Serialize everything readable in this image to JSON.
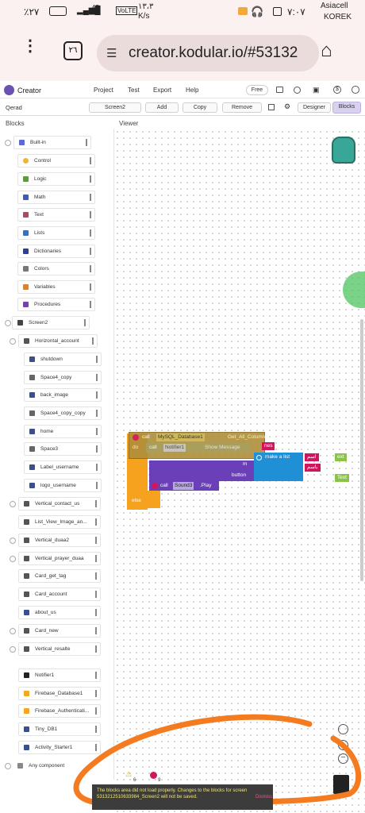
{
  "status": {
    "left": "٪٢٧",
    "battery": "",
    "net": "VoLTE",
    "speed": "١٣،٣",
    "speed_unit": "K/s",
    "time": "٧:٠٧",
    "carrier": "Asiacell",
    "carrier2": "KOREK",
    "sig": "4G"
  },
  "browser": {
    "tabs": "٢٦",
    "url": "creator.kodular.io/#53132"
  },
  "app": {
    "name": "Creator",
    "menu": [
      "Project",
      "Test",
      "Export",
      "Help"
    ],
    "plan": "Free"
  },
  "toolbar": {
    "project": "Qerad",
    "screen": "Screen2",
    "add": "Add",
    "copy": "Copy",
    "remove": "Remove",
    "designer": "Designer",
    "blocks": "Blocks"
  },
  "panes": {
    "blocks": "Blocks",
    "viewer": "Viewer"
  },
  "builtin": [
    "Built-in",
    "Control",
    "Logic",
    "Math",
    "Text",
    "Lists",
    "Dictionaries",
    "Colors",
    "Variables",
    "Procedures"
  ],
  "components": [
    "Screen2",
    "Horizontal_account",
    "shutdown",
    "Space4_copy",
    "back_image",
    "Space4_copy_copy",
    "home",
    "Space3",
    "Label_username",
    "logo_username",
    "Vertical_contact_us",
    "List_View_Image_an...",
    "Vertical_duaa2",
    "Vertical_prayer_duaa",
    "Card_get_tag",
    "Card_account",
    "about_us",
    "Card_new",
    "Vertical_resalte",
    "Notifier1",
    "Firebase_Database1",
    "Firebase_Authenticati...",
    "Tiny_DB1",
    "Activity_Starter1",
    "Any component"
  ],
  "blocks": {
    "call": "call",
    "db": "MySQL_Database1",
    "method": "Get_All_Columns",
    "notifier": "Notifier1",
    "show": "Show Message",
    "nes": "nes",
    "make_list": "make a list",
    "button": "button",
    "sound": "Sound3",
    "play": ".Play",
    "else": "else",
    "r1": "اسم",
    "r2": "ext",
    "r3": "باسم",
    "r4": "Text",
    "do": "do",
    "m": "m"
  },
  "warnings": {
    "count": "6",
    "errors": "9"
  },
  "toast": {
    "text": "The blocks area did not load properly. Changes to the blocks for screen 5313212510633984_Screen2 will not be saved.",
    "dismiss": "Dismiss"
  },
  "colors": {
    "accent": "#6a52b3",
    "orange": "#f6a21e",
    "purple": "#6a3fb8",
    "magenta": "#d0175e",
    "blue": "#1f8fd6",
    "olive": "#8a7d1f",
    "teal": "#3aa59a"
  }
}
